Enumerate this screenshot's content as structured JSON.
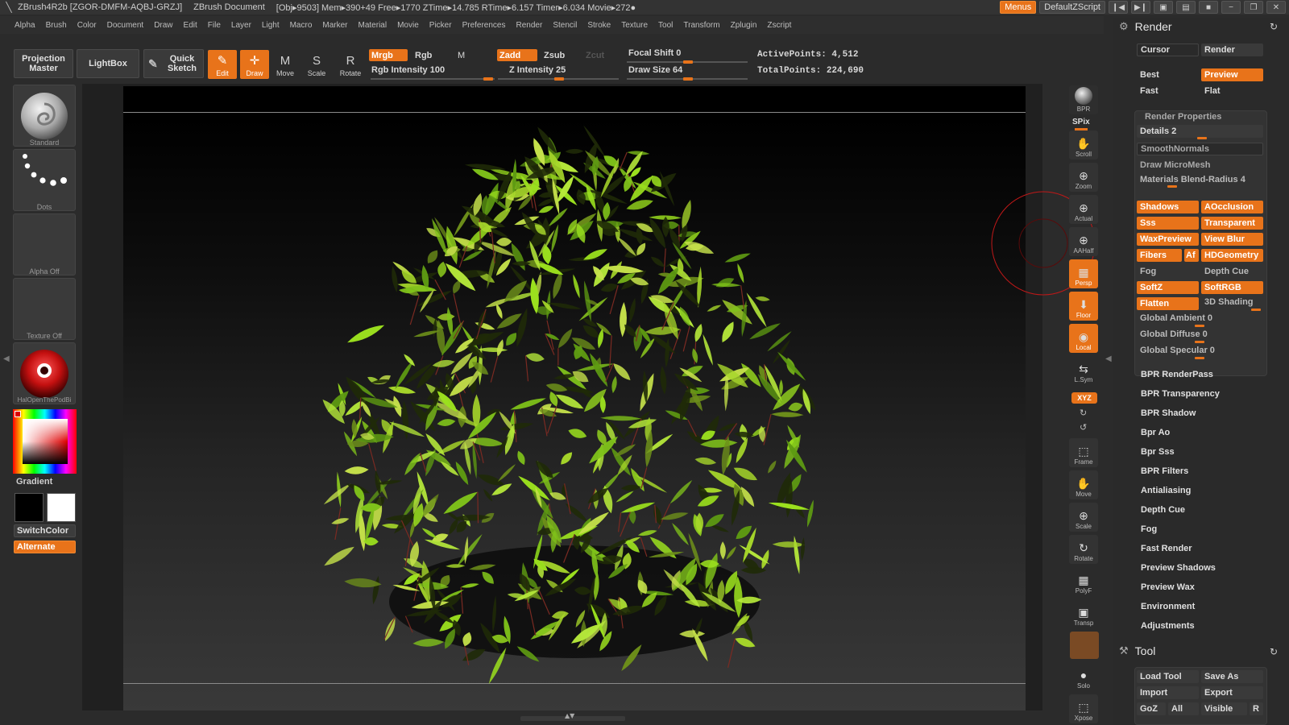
{
  "titlebar": {
    "app": "ZBrush4R2b [ZGOR-DMFM-AQBJ-GRZJ]",
    "document": "ZBrush Document",
    "stats": "[Obj▸9503] Mem▸390+49 Free▸1770 ZTime▸14.785 RTime▸6.157 Timer▸6.034 Movie▸272●",
    "menus_button": "Menus",
    "script_button": "DefaultZScript"
  },
  "menubar": [
    "Alpha",
    "Brush",
    "Color",
    "Document",
    "Draw",
    "Edit",
    "File",
    "Layer",
    "Light",
    "Macro",
    "Marker",
    "Material",
    "Movie",
    "Picker",
    "Preferences",
    "Render",
    "Stencil",
    "Stroke",
    "Texture",
    "Tool",
    "Transform",
    "Zplugin",
    "Zscript"
  ],
  "toolbar": {
    "projection_master": "Projection Master",
    "lightbox": "LightBox",
    "quick_sketch": "Quick Sketch",
    "modes": [
      {
        "label": "Edit",
        "glyph": "✎",
        "active": true
      },
      {
        "label": "Draw",
        "glyph": "✛",
        "active": true
      },
      {
        "label": "Move",
        "glyph": "M",
        "active": false
      },
      {
        "label": "Scale",
        "glyph": "S",
        "active": false
      },
      {
        "label": "Rotate",
        "glyph": "R",
        "active": false
      }
    ],
    "mrgb": "Mrgb",
    "rgb": "Rgb",
    "m": "M",
    "rgb_intensity_label": "Rgb Intensity 100",
    "zadd": "Zadd",
    "zsub": "Zsub",
    "zcut": "Zcut",
    "z_intensity_label": "Z Intensity 25",
    "focal_shift_label": "Focal Shift 0",
    "draw_size_label": "Draw Size 64",
    "active_points": "ActivePoints: 4,512",
    "total_points": "TotalPoints: 224,690"
  },
  "leftshelf": {
    "brush": "Standard",
    "stroke": "Dots",
    "alpha": "Alpha Off",
    "texture": "Texture Off",
    "material": "HalOpenThePodBi",
    "gradient": "Gradient",
    "switch_color": "SwitchColor",
    "alternate": "Alternate"
  },
  "rightshelf": [
    {
      "label": "BPR",
      "glyph": "●",
      "active": false
    },
    {
      "label": "SPix",
      "glyph": "",
      "active": false
    },
    {
      "label": "Scroll",
      "glyph": "✋",
      "active": false
    },
    {
      "label": "Zoom",
      "glyph": "⊕",
      "active": false
    },
    {
      "label": "Actual",
      "glyph": "⊕",
      "active": false
    },
    {
      "label": "AAHalf",
      "glyph": "⊕",
      "active": false
    },
    {
      "label": "Persp",
      "glyph": "▦",
      "active": true
    },
    {
      "label": "Floor",
      "glyph": "⬇",
      "active": true
    },
    {
      "label": "Local",
      "glyph": "◉",
      "active": true
    },
    {
      "label": "L.Sym",
      "glyph": "⇆",
      "active": false
    },
    {
      "label": "XYZ",
      "glyph": "",
      "active": true
    },
    {
      "label": "Frame",
      "glyph": "⬚",
      "active": false
    },
    {
      "label": "Move",
      "glyph": "✋",
      "active": false
    },
    {
      "label": "Scale",
      "glyph": "⊕",
      "active": false
    },
    {
      "label": "Rotate",
      "glyph": "↻",
      "active": false
    },
    {
      "label": "PolyF",
      "glyph": "▦",
      "active": false
    },
    {
      "label": "Transp",
      "glyph": "▣",
      "active": false
    },
    {
      "label": "Solo",
      "glyph": "●",
      "active": false
    },
    {
      "label": "Xpose",
      "glyph": "⬚",
      "active": false
    }
  ],
  "render_panel": {
    "title": "Render",
    "cursor": "Cursor",
    "render": "Render",
    "best": "Best",
    "preview": "Preview",
    "fast": "Fast",
    "flat": "Flat",
    "properties_title": "Render Properties",
    "details": "Details 2",
    "smooth_normals": "SmoothNormals",
    "draw_micromesh": "Draw MicroMesh",
    "materials_blend": "Materials Blend-Radius 4",
    "shadows": "Shadows",
    "aocclusion": "AOcclusion",
    "sss": "Sss",
    "transparent": "Transparent",
    "waxpreview": "WaxPreview",
    "view_blur": "View Blur",
    "fibers": "Fibers",
    "af": "Af",
    "hdgeometry": "HDGeometry",
    "fog": "Fog",
    "depth_cue_toggle": "Depth Cue",
    "softz": "SoftZ",
    "softrgb": "SoftRGB",
    "flatten": "Flatten",
    "shading_3d": "3D Shading",
    "global_ambient": "Global Ambient 0",
    "global_diffuse": "Global Diffuse 0",
    "global_specular": "Global Specular 0",
    "subpalettes": [
      "BPR RenderPass",
      "BPR Transparency",
      "BPR Shadow",
      "Bpr Ao",
      "Bpr Sss",
      "BPR Filters",
      "Antialiasing",
      "Depth Cue",
      "Fog",
      "Fast Render",
      "Preview Shadows",
      "Preview Wax",
      "Environment",
      "Adjustments"
    ]
  },
  "tool_panel": {
    "title": "Tool",
    "load_tool": "Load Tool",
    "save_as": "Save As",
    "import": "Import",
    "export": "Export",
    "goz": "GoZ",
    "all": "All",
    "visible": "Visible",
    "r": "R"
  },
  "colors": {
    "accent": "#e8731a",
    "panel": "#2a2a2a",
    "foliage": "#8fcf1f"
  }
}
